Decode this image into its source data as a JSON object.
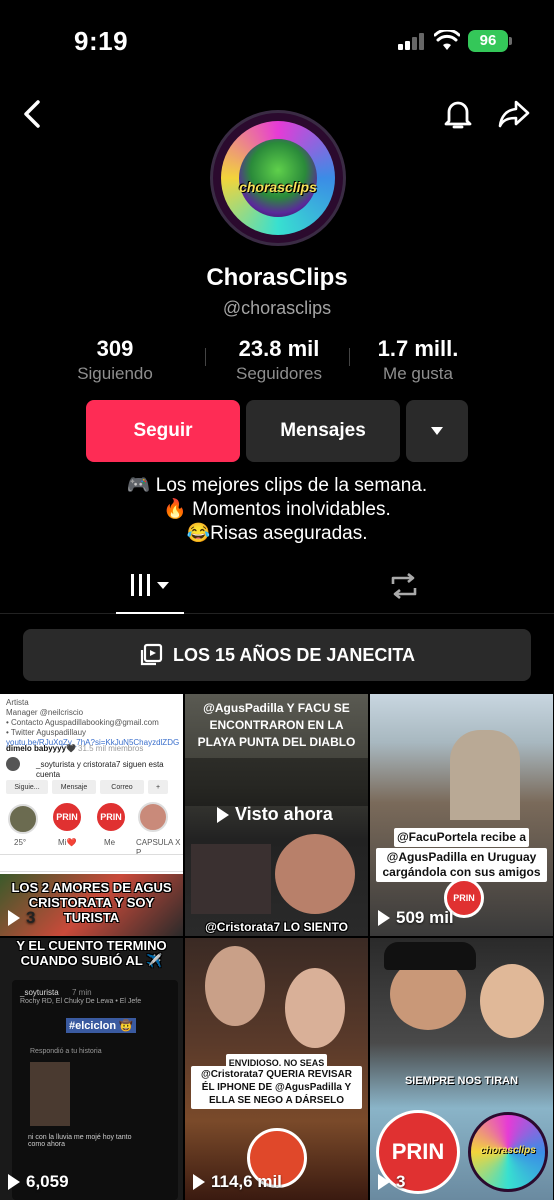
{
  "status_bar": {
    "time": "9:19",
    "battery": "96"
  },
  "profile": {
    "avatar_text": "chorasclips",
    "name": "ChorasClips",
    "handle": "@chorasclips"
  },
  "stats": [
    {
      "value": "309",
      "label": "Siguiendo"
    },
    {
      "value": "23.8 mil",
      "label": "Seguidores"
    },
    {
      "value": "1.7 mill.",
      "label": "Me gusta"
    }
  ],
  "actions": {
    "follow": "Seguir",
    "message": "Mensajes"
  },
  "bio": [
    "🎮 Los mejores clips de la semana.",
    "🔥 Momentos inolvidables.",
    "😂Risas aseguradas."
  ],
  "playlist": {
    "label": "LOS 15 AÑOS DE JANECITA"
  },
  "videos": [
    {
      "caption": "LOS 2 AMORES DE AGUS CRISTORATA Y SOY TURISTA",
      "views": "3",
      "mini": {
        "artist": "Artista",
        "manager": "Manager @neilcriscio",
        "contact": "• Contacto Aguspadillabooking@gmail.com",
        "twitter": "• Twitter Aguspadillauy",
        "link": "youtu.be/RJuXqZv_7hA?si=KkJuN5ChayzdlZDG",
        "group": "dimelo babyyyy🖤",
        "members": "31.5 mil miembros",
        "follows": "_soyturista y cristorata7 siguen esta cuenta",
        "btn1": "Siguie...",
        "btn2": "Mensaje",
        "btn3": "Correo",
        "hl1": "25°",
        "hl2": "Mi❤️",
        "hl3": "Me",
        "hl4": "CAPSULA X P..."
      }
    },
    {
      "caption": "@AgusPadilla Y FACU SE ENCONTRARON EN LA PLAYA PUNTA DEL DIABLO",
      "watched": "Visto ahora",
      "bottom_text": "@Cristorata7 LO SIENTO"
    },
    {
      "caption_a": "@FacuPortela recibe a",
      "caption_b": "@AgusPadilla en Uruguay cargándola con sus amigos",
      "views": "509 mil"
    },
    {
      "caption": "Y EL CUENTO TERMINO CUANDO SUBIÓ AL ✈️",
      "views": "6,059",
      "story_user": "_soyturista",
      "story_time": "7 min",
      "story_song": "Rochy RD, El Chuky De Lewa • El Jefe",
      "story_tag": "#elciclon 🤠",
      "story_reply": "Respondió a tu historia",
      "story_msg": "ni con la lluvia me mojé hoy tanto como ahora"
    },
    {
      "caption_a": "ENVIDIOSO. NO SEAS",
      "caption_b": "@Cristorata7 QUERIA REVISAR ÉL IPHONE DE @AgusPadilla Y ELLA SE NEGO A DÁRSELO",
      "views": "114,6 mil"
    },
    {
      "caption": "SIEMPRE NOS TIRAN",
      "views": "3"
    }
  ],
  "badge_text": "PRIN"
}
